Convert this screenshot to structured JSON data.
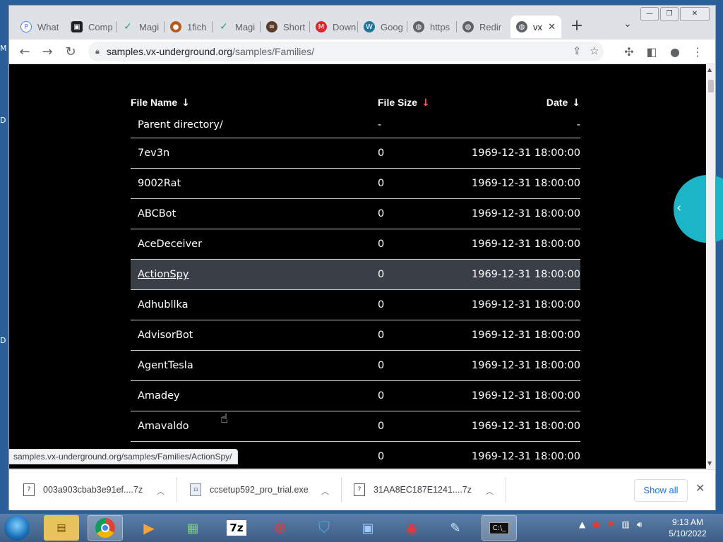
{
  "desktop": {
    "left_letters": [
      "M",
      "D",
      "D"
    ]
  },
  "window": {
    "buttons": [
      "minimize",
      "maximize",
      "close"
    ]
  },
  "tabs": [
    {
      "label": "What",
      "icon": "pinterest-icon",
      "color": "#4285f4"
    },
    {
      "label": "Comp",
      "icon": "square-logo-icon",
      "color": "#202124"
    },
    {
      "label": "Magi",
      "icon": "leaf-icon",
      "color": "#1fa463"
    },
    {
      "label": "1fich",
      "icon": "squirrel-icon",
      "color": "#b35c1e"
    },
    {
      "label": "Magi",
      "icon": "leaf-icon",
      "color": "#1fa463"
    },
    {
      "label": "Short",
      "icon": "burger-icon",
      "color": "#5b3a29"
    },
    {
      "label": "Down",
      "icon": "mega-icon",
      "color": "#d9272e"
    },
    {
      "label": "Goog",
      "icon": "wordpress-icon",
      "color": "#21759b"
    },
    {
      "label": "https",
      "icon": "globe-icon",
      "color": "#5f6368"
    },
    {
      "label": "Redir",
      "icon": "globe-icon",
      "color": "#5f6368"
    },
    {
      "label": "vx",
      "icon": "globe-icon",
      "color": "#5f6368",
      "active": true
    }
  ],
  "toolbar": {
    "url_host": "samples.vx-underground.org",
    "url_path": "/samples/Families/"
  },
  "listing": {
    "headers": {
      "name": "File Name",
      "size": "File Size",
      "date": "Date",
      "arrow": "↓"
    },
    "rows": [
      {
        "name": "Parent directory/",
        "size": "-",
        "date": "-"
      },
      {
        "name": "7ev3n",
        "size": "0",
        "date": "1969-12-31 18:00:00"
      },
      {
        "name": "9002Rat",
        "size": "0",
        "date": "1969-12-31 18:00:00"
      },
      {
        "name": "ABCBot",
        "size": "0",
        "date": "1969-12-31 18:00:00"
      },
      {
        "name": "AceDeceiver",
        "size": "0",
        "date": "1969-12-31 18:00:00"
      },
      {
        "name": "ActionSpy",
        "size": "0",
        "date": "1969-12-31 18:00:00",
        "hover": true
      },
      {
        "name": "Adhubllka",
        "size": "0",
        "date": "1969-12-31 18:00:00"
      },
      {
        "name": "AdvisorBot",
        "size": "0",
        "date": "1969-12-31 18:00:00"
      },
      {
        "name": "AgentTesla",
        "size": "0",
        "date": "1969-12-31 18:00:00"
      },
      {
        "name": "Amadey",
        "size": "0",
        "date": "1969-12-31 18:00:00"
      },
      {
        "name": "Amavaldo",
        "size": "0",
        "date": "1969-12-31 18:00:00"
      },
      {
        "name": "",
        "size": "0",
        "date": "1969-12-31 18:00:00"
      }
    ]
  },
  "status_url": "samples.vx-underground.org/samples/Families/ActionSpy/",
  "downloads": {
    "items": [
      "003a903cbab3e91ef....7z",
      "ccsetup592_pro_trial.exe",
      "31AA8EC187E1241....7z"
    ],
    "show_all": "Show all"
  },
  "taskbar": {
    "apps": [
      "file-explorer",
      "chrome",
      "media-player",
      "task-manager",
      "7zip",
      "security-tool",
      "vpn-shield",
      "process-explorer",
      "screen-recorder",
      "notepad",
      "command-prompt"
    ],
    "time": "9:13 AM",
    "date": "5/10/2022"
  },
  "colors": {
    "accent_teal": "#1bb5c7",
    "hover_row": "#3a3f47",
    "link_blue": "#1a73e8"
  }
}
